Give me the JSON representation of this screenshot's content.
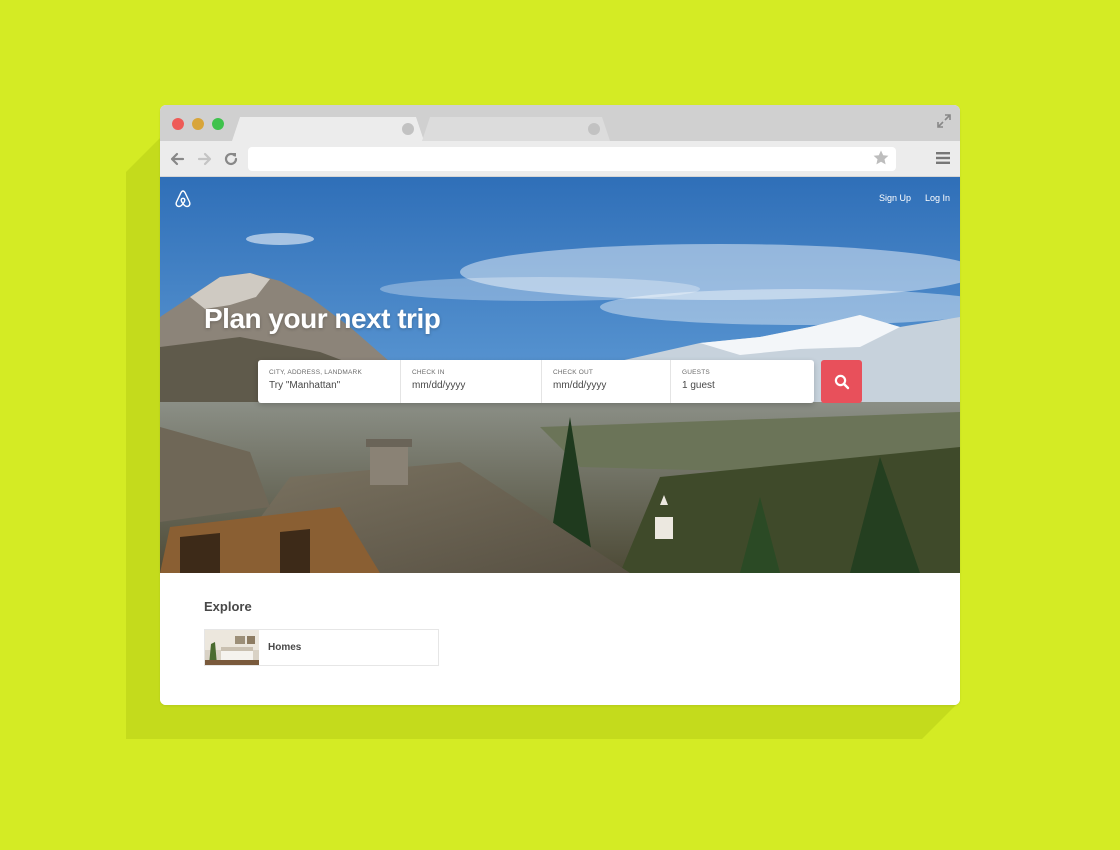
{
  "colors": {
    "background": "#d4eb24",
    "brand": "#e8505b",
    "text": "#484848"
  },
  "browser": {
    "icons": [
      "back-arrow-icon",
      "forward-arrow-icon",
      "reload-icon",
      "star-icon",
      "menu-icon",
      "expand-icon"
    ],
    "address": ""
  },
  "header": {
    "logo": "airbnb-logo-icon",
    "links": {
      "signup": "Sign Up",
      "login": "Log In"
    }
  },
  "hero": {
    "title": "Plan your next trip"
  },
  "search": {
    "location": {
      "label": "CITY, ADDRESS, LANDMARK",
      "value": "Try \"Manhattan\""
    },
    "checkin": {
      "label": "CHECK IN",
      "value": "mm/dd/yyyy"
    },
    "checkout": {
      "label": "CHECK OUT",
      "value": "mm/dd/yyyy"
    },
    "guests": {
      "label": "GUESTS",
      "value": "1 guest"
    },
    "button_icon": "search-icon"
  },
  "explore": {
    "title": "Explore",
    "cards": [
      {
        "label": "Homes"
      }
    ]
  }
}
